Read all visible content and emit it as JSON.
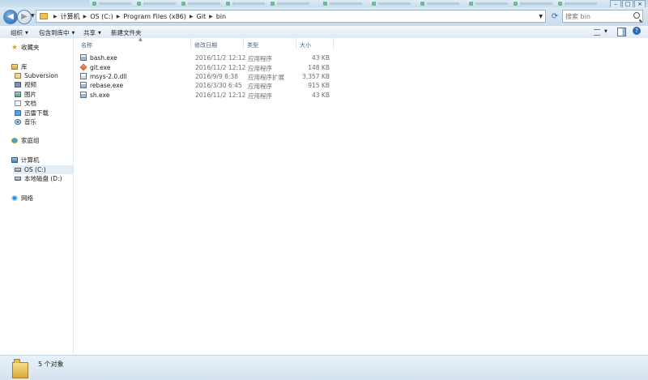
{
  "window": {
    "ghost_tabs": 11
  },
  "address_bar": {
    "crumbs": [
      "计算机",
      "OS (C:)",
      "Program Files (x86)",
      "Git",
      "bin"
    ]
  },
  "search": {
    "placeholder": "搜索 bin"
  },
  "toolbar": {
    "organize": "组织",
    "include_in_library": "包含到库中",
    "share": "共享",
    "new_folder": "新建文件夹"
  },
  "nav": {
    "favorites": "收藏夹",
    "library": "库",
    "subversion": "Subversion",
    "videos": "视频",
    "pictures": "图片",
    "documents": "文档",
    "thunder": "迅雷下载",
    "music": "音乐",
    "homegroup": "家庭组",
    "computer": "计算机",
    "drive_c": "OS (C:)",
    "drive_d": "本地磁盘 (D:)",
    "network": "网络"
  },
  "columns": {
    "name": "名称",
    "date": "修改日期",
    "type": "类型",
    "size": "大小"
  },
  "files": [
    {
      "name": "bash.exe",
      "date": "2016/11/2 12:12",
      "type": "应用程序",
      "size": "43 KB"
    },
    {
      "name": "git.exe",
      "date": "2016/11/2 12:12",
      "type": "应用程序",
      "size": "148 KB"
    },
    {
      "name": "msys-2.0.dll",
      "date": "2016/9/9 8:38",
      "type": "应用程序扩展",
      "size": "3,357 KB"
    },
    {
      "name": "rebase.exe",
      "date": "2016/3/30 6:45",
      "type": "应用程序",
      "size": "915 KB"
    },
    {
      "name": "sh.exe",
      "date": "2016/11/2 12:12",
      "type": "应用程序",
      "size": "43 KB"
    }
  ],
  "status": {
    "item_count": "5 个对象"
  }
}
